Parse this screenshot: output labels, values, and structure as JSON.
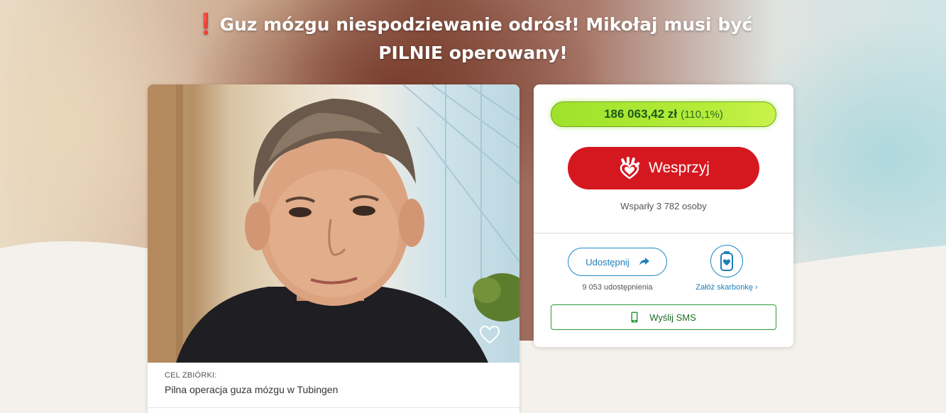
{
  "page": {
    "title_line1": "Guz mózgu niespodziewanie odrósł! Mikołaj musi być",
    "title_line2": "PILNIE operowany!",
    "title_emoji": "❗"
  },
  "campaign": {
    "goal_label": "CEL ZBIÓRKI:",
    "goal_text": "Pilna operacja guza mózgu w Tubingen"
  },
  "donation": {
    "amount": "186 063,42 zł",
    "percent": "(110,1%)",
    "support_label": "Wesprzyj",
    "supporters": "Wsparły 3 782 osoby",
    "share_label": "Udostępnij",
    "share_count": "9 053 udostępnienia",
    "piggy_label": "Załóż skarbonkę ›",
    "sms_label": "Wyślij SMS"
  },
  "colors": {
    "support_red": "#d5181f",
    "progress_green": "#a8e632",
    "link_blue": "#1e7fb8",
    "sms_green": "#2c9a3a"
  },
  "icons": {
    "support": "hand-heart-icon",
    "share": "share-arrow-icon",
    "piggy": "piggy-bank-icon",
    "sms": "phone-icon",
    "favorite": "heart-outline-icon"
  }
}
